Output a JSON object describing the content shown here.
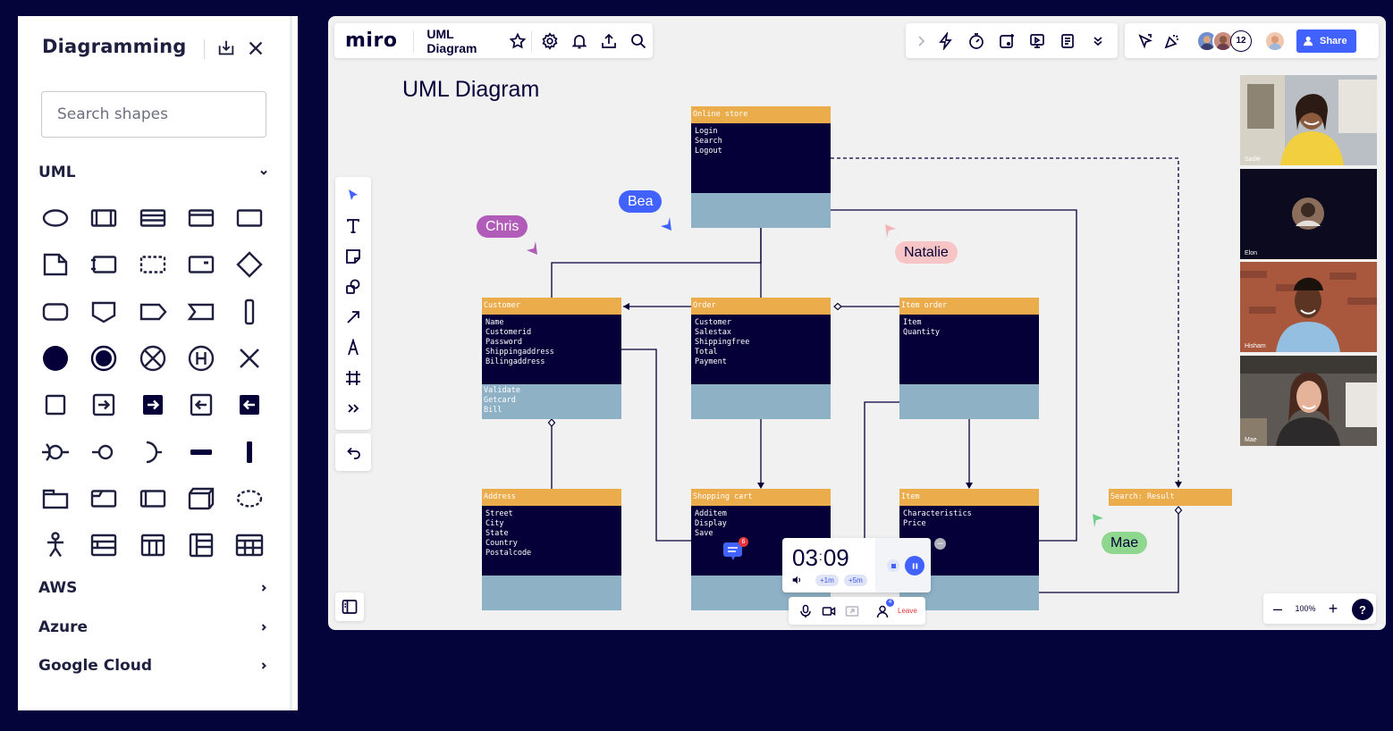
{
  "shape_panel": {
    "title": "Diagramming",
    "search_placeholder": "Search shapes",
    "sections": [
      {
        "label": "UML",
        "state": "expanded"
      },
      {
        "label": "AWS",
        "state": "collapsed"
      },
      {
        "label": "Azure",
        "state": "collapsed"
      },
      {
        "label": "Google Cloud",
        "state": "collapsed"
      }
    ]
  },
  "top_bar": {
    "logo": "miro",
    "board_name": "UML Diagram",
    "share_label": "Share",
    "collaborator_count": "12"
  },
  "board": {
    "title": "UML Diagram",
    "classes": {
      "online_store": {
        "name": "Online store",
        "attrs": "Login\nSearch\nLogout",
        "ops": ""
      },
      "customer": {
        "name": "Customer",
        "attrs": "Name\nCustomerid\nPassword\nShippingaddress\nBilingaddress",
        "ops": "Validate\nGetcard\nBill"
      },
      "order": {
        "name": "Order",
        "attrs": "Customer\nSalestax\nShippingfree\nTotal\nPayment",
        "ops": ""
      },
      "item_order": {
        "name": "Item order",
        "attrs": "Item\nQuantity",
        "ops": ""
      },
      "address": {
        "name": "Address",
        "attrs": "Street\nCity\nState\nCountry\nPostalcode",
        "ops": ""
      },
      "shopping_cart": {
        "name": "Shopping cart",
        "attrs": "Additem\nDisplay\nSave",
        "ops": ""
      },
      "item": {
        "name": "Item",
        "attrs": "Characteristics\nPrice",
        "ops": ""
      },
      "search_result": {
        "name": "Search: Result"
      }
    },
    "cursors": [
      {
        "name": "Chris",
        "color": "#b05cb8"
      },
      {
        "name": "Bea",
        "color": "#4262ff"
      },
      {
        "name": "Natalie",
        "color": "#f7c5c5"
      },
      {
        "name": "Mae",
        "color": "#8fd68e"
      }
    ],
    "comment_badge": "6",
    "timer": {
      "minutes": "03",
      "seconds": "09",
      "add1": "+1m",
      "add5": "+5m"
    },
    "call": {
      "participant_badge": "4",
      "leave_label": "Leave"
    },
    "zoom": "100%",
    "help": "?",
    "videos": [
      "Sadie",
      "Elon",
      "Hisham",
      "Mae"
    ]
  },
  "colors": {
    "header_orange": "#ebac4c",
    "class_navy": "#050038",
    "ops_blue": "#8fb1c6",
    "accent_blue": "#4262ff",
    "page_bg": "#05043a"
  }
}
